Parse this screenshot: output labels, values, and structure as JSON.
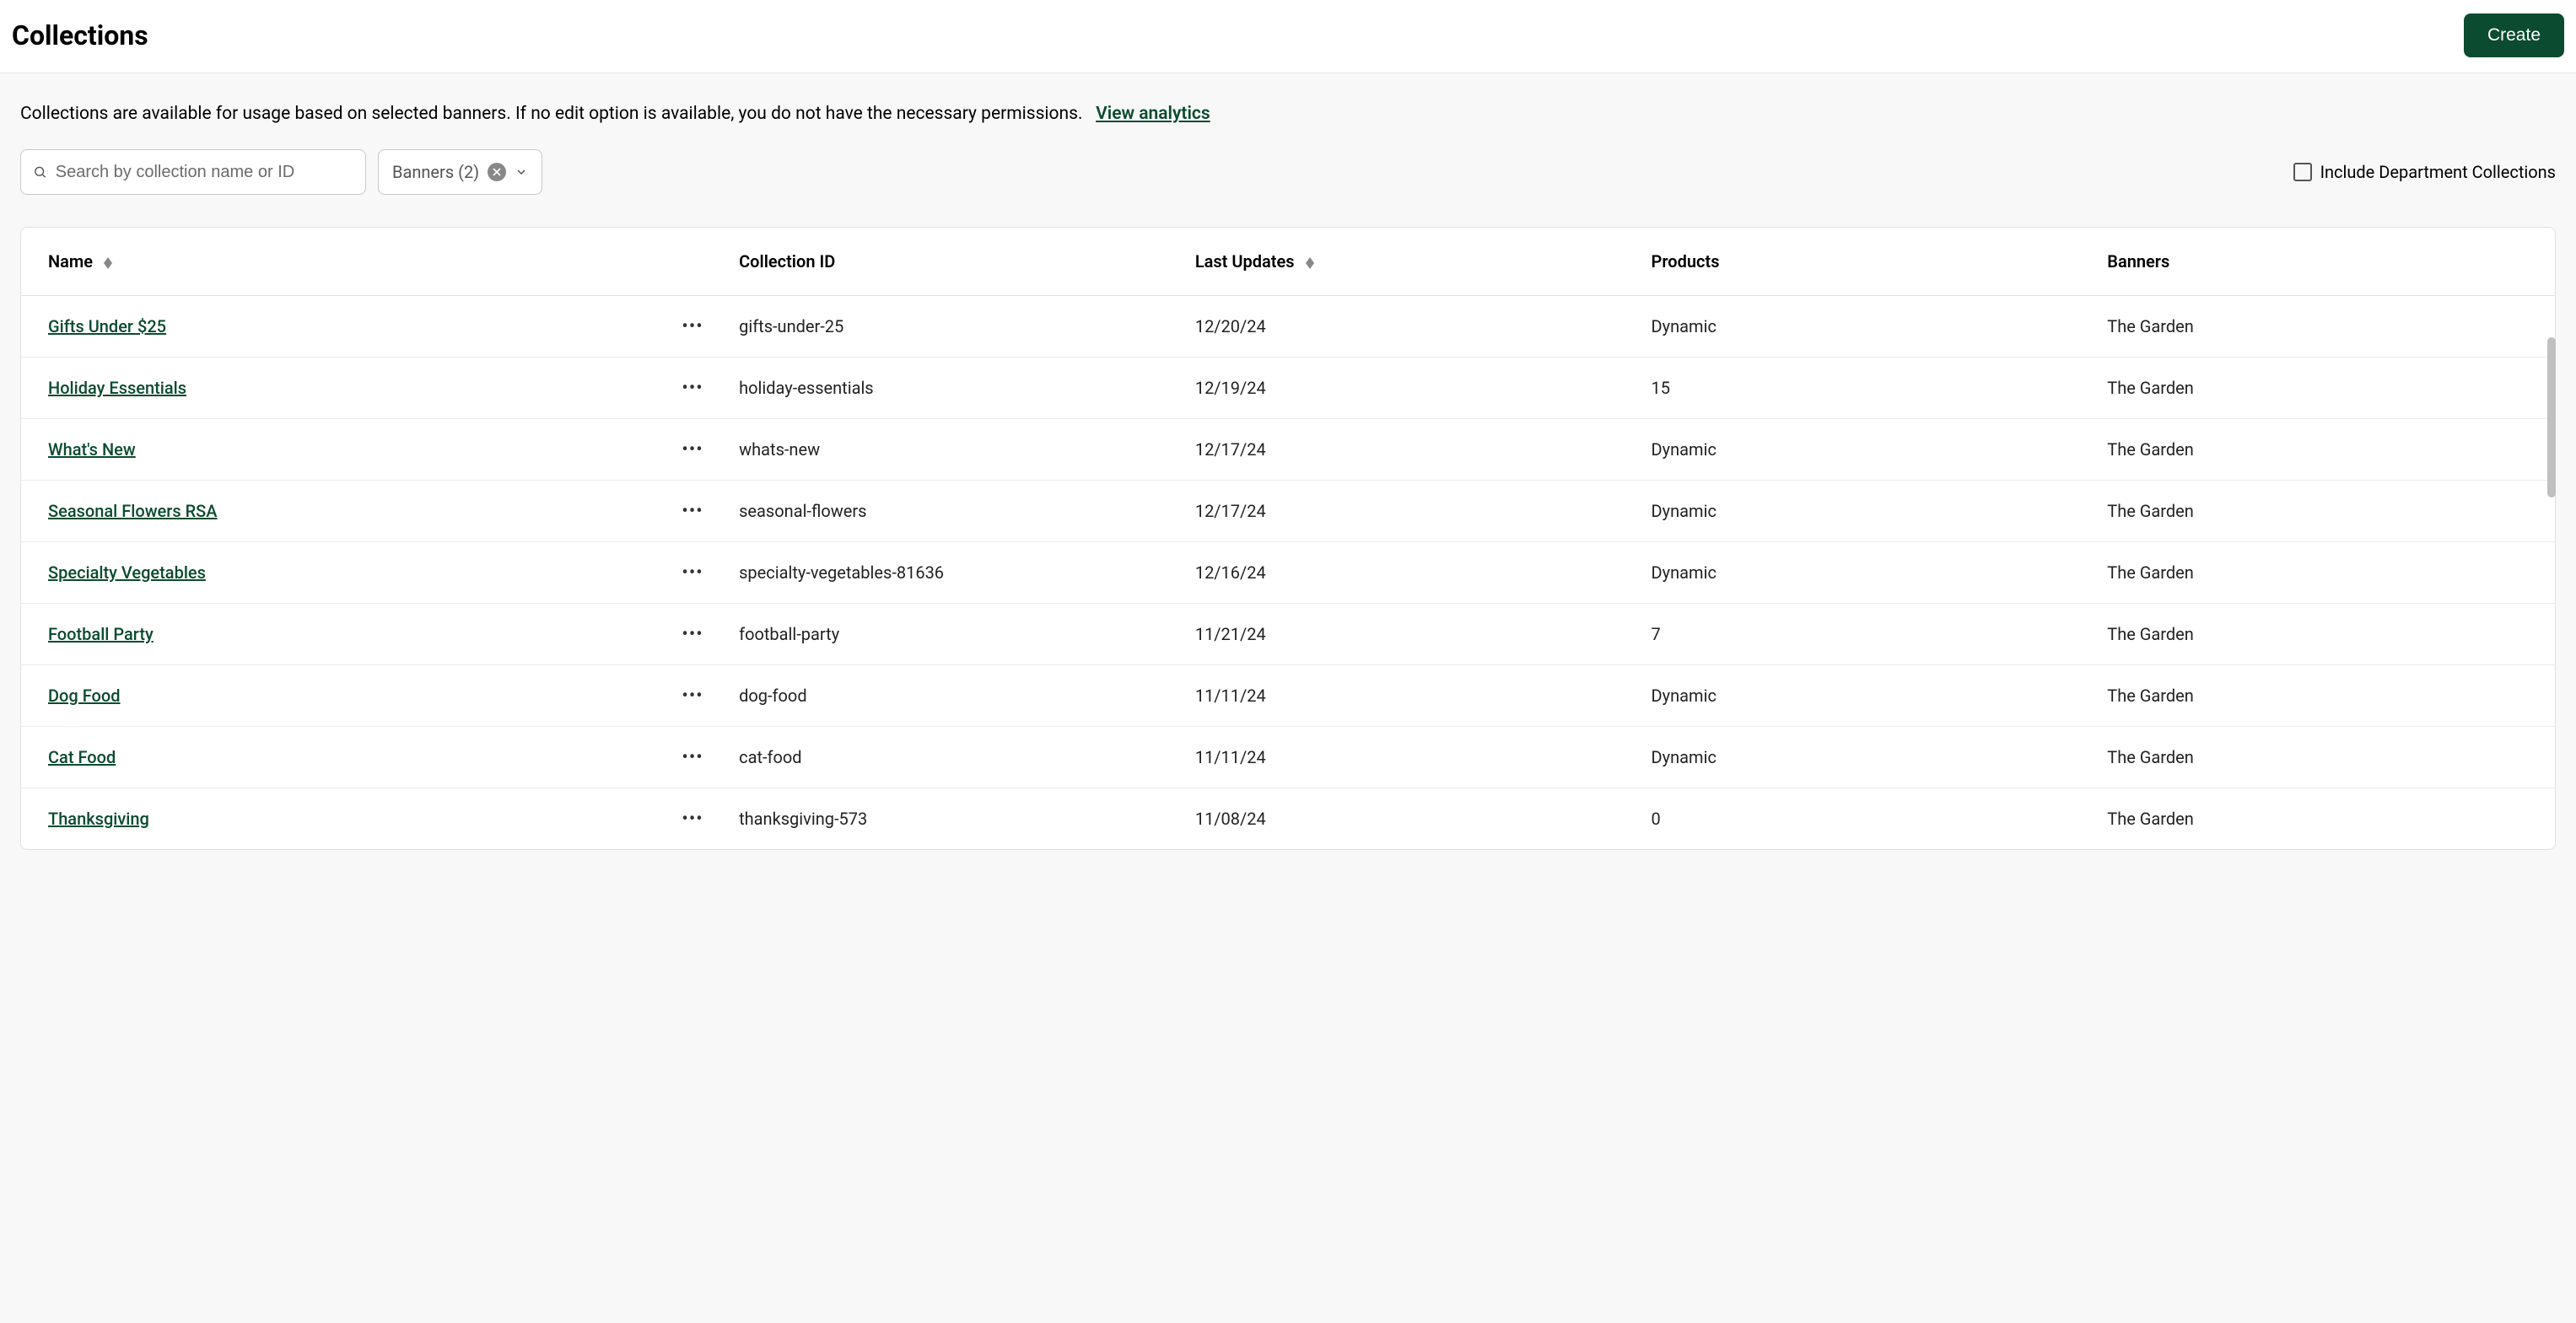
{
  "header": {
    "title": "Collections",
    "create_label": "Create"
  },
  "info": {
    "text": "Collections are available for usage based on selected banners. If no edit option is available, you do not have the necessary permissions.",
    "analytics_label": "View analytics"
  },
  "controls": {
    "search_placeholder": "Search by collection name or ID",
    "filter_label": "Banners (2)",
    "include_dept_label": "Include Department Collections"
  },
  "table": {
    "headers": {
      "name": "Name",
      "collection_id": "Collection ID",
      "last_updates": "Last Updates",
      "products": "Products",
      "banners": "Banners"
    },
    "rows": [
      {
        "name": "Gifts Under $25",
        "id": "gifts-under-25",
        "updated": "12/20/24",
        "products": "Dynamic",
        "banners": "The Garden"
      },
      {
        "name": "Holiday Essentials",
        "id": "holiday-essentials",
        "updated": "12/19/24",
        "products": "15",
        "banners": "The Garden"
      },
      {
        "name": "What's New",
        "id": "whats-new",
        "updated": "12/17/24",
        "products": "Dynamic",
        "banners": "The Garden"
      },
      {
        "name": "Seasonal Flowers RSA",
        "id": "seasonal-flowers",
        "updated": "12/17/24",
        "products": "Dynamic",
        "banners": "The Garden"
      },
      {
        "name": "Specialty Vegetables",
        "id": "specialty-vegetables-81636",
        "updated": "12/16/24",
        "products": "Dynamic",
        "banners": "The Garden"
      },
      {
        "name": "Football Party",
        "id": "football-party",
        "updated": "11/21/24",
        "products": "7",
        "banners": "The Garden"
      },
      {
        "name": "Dog Food",
        "id": "dog-food",
        "updated": "11/11/24",
        "products": "Dynamic",
        "banners": "The Garden"
      },
      {
        "name": "Cat Food",
        "id": "cat-food",
        "updated": "11/11/24",
        "products": "Dynamic",
        "banners": "The Garden"
      },
      {
        "name": "Thanksgiving",
        "id": "thanksgiving-573",
        "updated": "11/08/24",
        "products": "0",
        "banners": "The Garden"
      }
    ]
  }
}
